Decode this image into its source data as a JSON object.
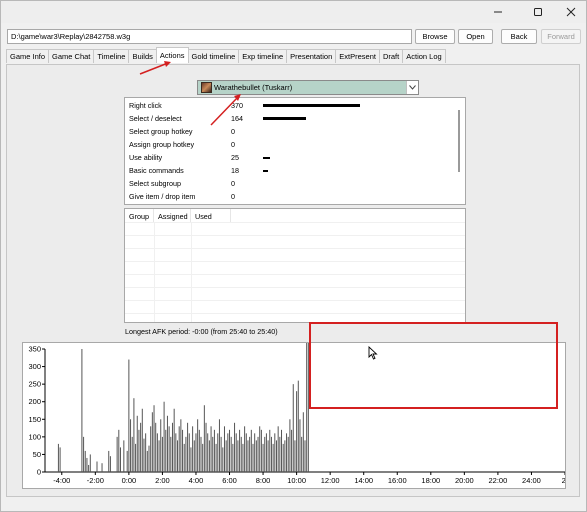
{
  "window": {
    "minimize_icon": "minimize-icon",
    "maximize_icon": "maximize-icon",
    "close_icon": "close-icon"
  },
  "toolbar": {
    "path_value": "D:\\game\\war3\\Replay\\2842758.w3g",
    "browse_label": "Browse",
    "open_label": "Open",
    "back_label": "Back",
    "forward_label": "Forward"
  },
  "tabs": [
    {
      "label": "Game Info"
    },
    {
      "label": "Game Chat"
    },
    {
      "label": "Timeline"
    },
    {
      "label": "Builds"
    },
    {
      "label": "Actions"
    },
    {
      "label": "Gold timeline"
    },
    {
      "label": "Exp timeline"
    },
    {
      "label": "Presentation"
    },
    {
      "label": "ExtPresent"
    },
    {
      "label": "Draft"
    },
    {
      "label": "Action Log"
    }
  ],
  "active_tab": "Actions",
  "player_select": {
    "value": "Warathebullet (Tuskarr)",
    "icon": "hero-portrait-icon"
  },
  "actions": [
    {
      "name": "Right click",
      "value": "370",
      "num": 370
    },
    {
      "name": "Select / deselect",
      "value": "164",
      "num": 164
    },
    {
      "name": "Select group hotkey",
      "value": "0",
      "num": 0
    },
    {
      "name": "Assign group hotkey",
      "value": "0",
      "num": 0
    },
    {
      "name": "Use ability",
      "value": "25",
      "num": 25
    },
    {
      "name": "Basic commands",
      "value": "18",
      "num": 18
    },
    {
      "name": "Select subgroup",
      "value": "0",
      "num": 0
    },
    {
      "name": "Give item / drop item",
      "value": "0",
      "num": 0
    }
  ],
  "groups_table": {
    "headers": [
      "Group",
      "Assigned",
      "Used"
    ]
  },
  "afk_text": "Longest AFK period: -0:00 (from 25:40 to 25:40)",
  "chart_data": {
    "type": "bar",
    "x_unit": "game time (minutes)",
    "xlim": [
      -5,
      26
    ],
    "ylim": [
      0,
      350
    ],
    "x_tick_labels": [
      "-4:00",
      "-2:00",
      "0:00",
      "2:00",
      "4:00",
      "6:00",
      "8:00",
      "10:00",
      "12:00",
      "14:00",
      "16:00",
      "18:00",
      "20:00",
      "22:00",
      "24:00",
      "2("
    ],
    "x_tick_values": [
      -4,
      -2,
      0,
      2,
      4,
      6,
      8,
      10,
      12,
      14,
      16,
      18,
      20,
      22,
      24,
      26
    ],
    "y_tick_labels": [
      "0",
      "50",
      "100",
      "150",
      "200",
      "250",
      "300",
      "350"
    ],
    "y_tick_values": [
      0,
      50,
      100,
      150,
      200,
      250,
      300,
      350
    ],
    "x": [
      -4.2,
      -4.1,
      -2.8,
      -2.7,
      -2.6,
      -2.5,
      -2.4,
      -2.3,
      -1.9,
      -1.6,
      -1.2,
      -1.1,
      -0.7,
      -0.6,
      -0.5,
      -0.3,
      -0.1,
      0.0,
      0.1,
      0.2,
      0.3,
      0.4,
      0.5,
      0.6,
      0.7,
      0.8,
      0.9,
      1.0,
      1.1,
      1.2,
      1.3,
      1.4,
      1.5,
      1.6,
      1.7,
      1.8,
      1.9,
      2.0,
      2.1,
      2.2,
      2.3,
      2.4,
      2.5,
      2.6,
      2.7,
      2.8,
      2.9,
      3.0,
      3.1,
      3.2,
      3.3,
      3.4,
      3.5,
      3.6,
      3.7,
      3.8,
      3.9,
      4.0,
      4.1,
      4.2,
      4.3,
      4.4,
      4.5,
      4.6,
      4.7,
      4.8,
      4.9,
      5.0,
      5.1,
      5.2,
      5.3,
      5.4,
      5.5,
      5.6,
      5.7,
      5.8,
      5.9,
      6.0,
      6.1,
      6.2,
      6.3,
      6.4,
      6.5,
      6.6,
      6.7,
      6.8,
      6.9,
      7.0,
      7.1,
      7.2,
      7.3,
      7.4,
      7.5,
      7.6,
      7.7,
      7.8,
      7.9,
      8.0,
      8.1,
      8.2,
      8.3,
      8.4,
      8.5,
      8.6,
      8.7,
      8.8,
      8.9,
      9.0,
      9.1,
      9.2,
      9.3,
      9.4,
      9.5,
      9.6,
      9.7,
      9.8,
      9.9,
      10.0,
      10.1,
      10.2,
      10.3,
      10.4,
      10.5,
      10.6,
      10.7
    ],
    "values": [
      80,
      70,
      350,
      100,
      60,
      40,
      20,
      50,
      30,
      25,
      60,
      45,
      100,
      120,
      70,
      90,
      60,
      320,
      150,
      100,
      210,
      80,
      160,
      120,
      140,
      180,
      95,
      110,
      60,
      75,
      130,
      170,
      190,
      140,
      110,
      90,
      150,
      100,
      200,
      120,
      160,
      130,
      100,
      140,
      180,
      110,
      90,
      130,
      150,
      120,
      80,
      100,
      140,
      110,
      70,
      130,
      90,
      110,
      150,
      120,
      100,
      80,
      190,
      140,
      110,
      90,
      130,
      100,
      120,
      80,
      110,
      150,
      100,
      70,
      130,
      90,
      110,
      120,
      100,
      80,
      140,
      110,
      90,
      120,
      100,
      80,
      130,
      110,
      90,
      100,
      120,
      80,
      110,
      90,
      100,
      130,
      120,
      80,
      100,
      110,
      90,
      120,
      100,
      80,
      110,
      90,
      130,
      100,
      120,
      80,
      90,
      110,
      100,
      150,
      120,
      250,
      90,
      230,
      260,
      150,
      100,
      170,
      90
    ],
    "grid": false,
    "legend": "none"
  }
}
